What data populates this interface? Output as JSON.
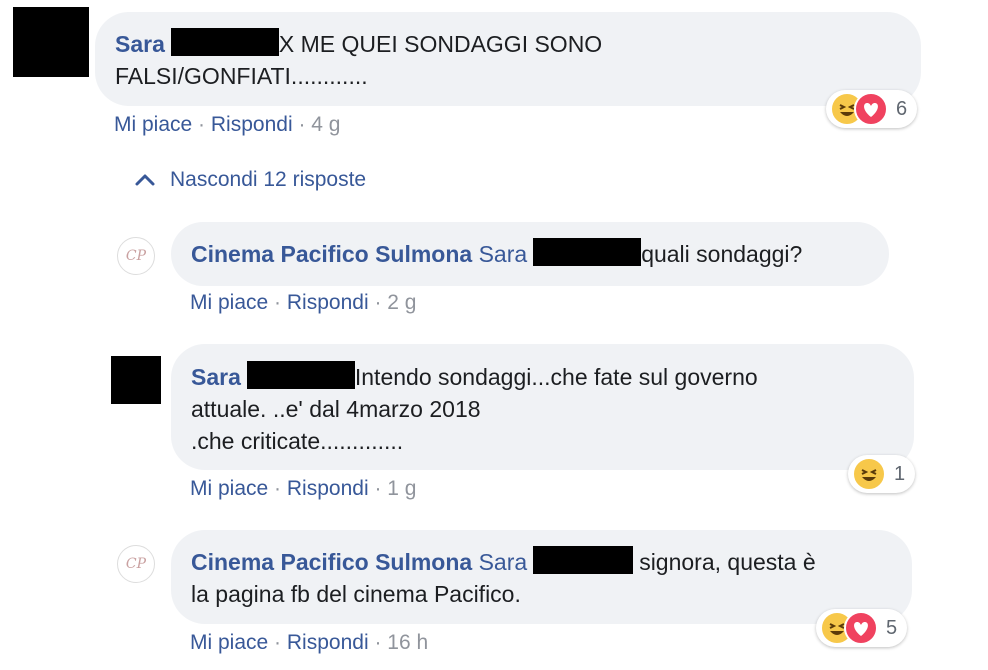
{
  "comment1": {
    "author": "Sara",
    "text_line1": "X ME QUEI SONDAGGI SONO",
    "text_line2": "FALSI/GONFIATI............",
    "like": "Mi piace",
    "reply": "Rispondi",
    "time": "4 g",
    "reaction_count": "6",
    "reactions": [
      "haha",
      "love"
    ]
  },
  "hide_replies": {
    "label": "Nascondi 12 risposte"
  },
  "reply1": {
    "author": "Cinema Pacifico Sulmona",
    "mention": "Sara",
    "text": "quali sondaggi?",
    "like": "Mi piace",
    "reply": "Rispondi",
    "time": "2 g"
  },
  "reply2": {
    "author": "Sara",
    "text_line1": "Intendo sondaggi...che fate sul governo",
    "text_line2": "attuale. ..e' dal 4marzo 2018",
    "text_line3": ".che criticate.............",
    "like": "Mi piace",
    "reply": "Rispondi",
    "time": "1 g",
    "reaction_count": "1",
    "reactions": [
      "haha"
    ]
  },
  "reply3": {
    "author": "Cinema Pacifico Sulmona",
    "mention": "Sara",
    "text_line1": "signora, questa è",
    "text_line2": "la pagina fb del cinema Pacifico.",
    "like": "Mi piace",
    "reply": "Rispondi",
    "time": "16 h",
    "reaction_count": "5",
    "reactions": [
      "haha",
      "love"
    ]
  },
  "separator": "·",
  "colors": {
    "link": "#385898",
    "bubble": "#f0f2f5",
    "haha": "#f7c84a",
    "love": "#f0425f"
  },
  "avatar_monogram": "CP"
}
